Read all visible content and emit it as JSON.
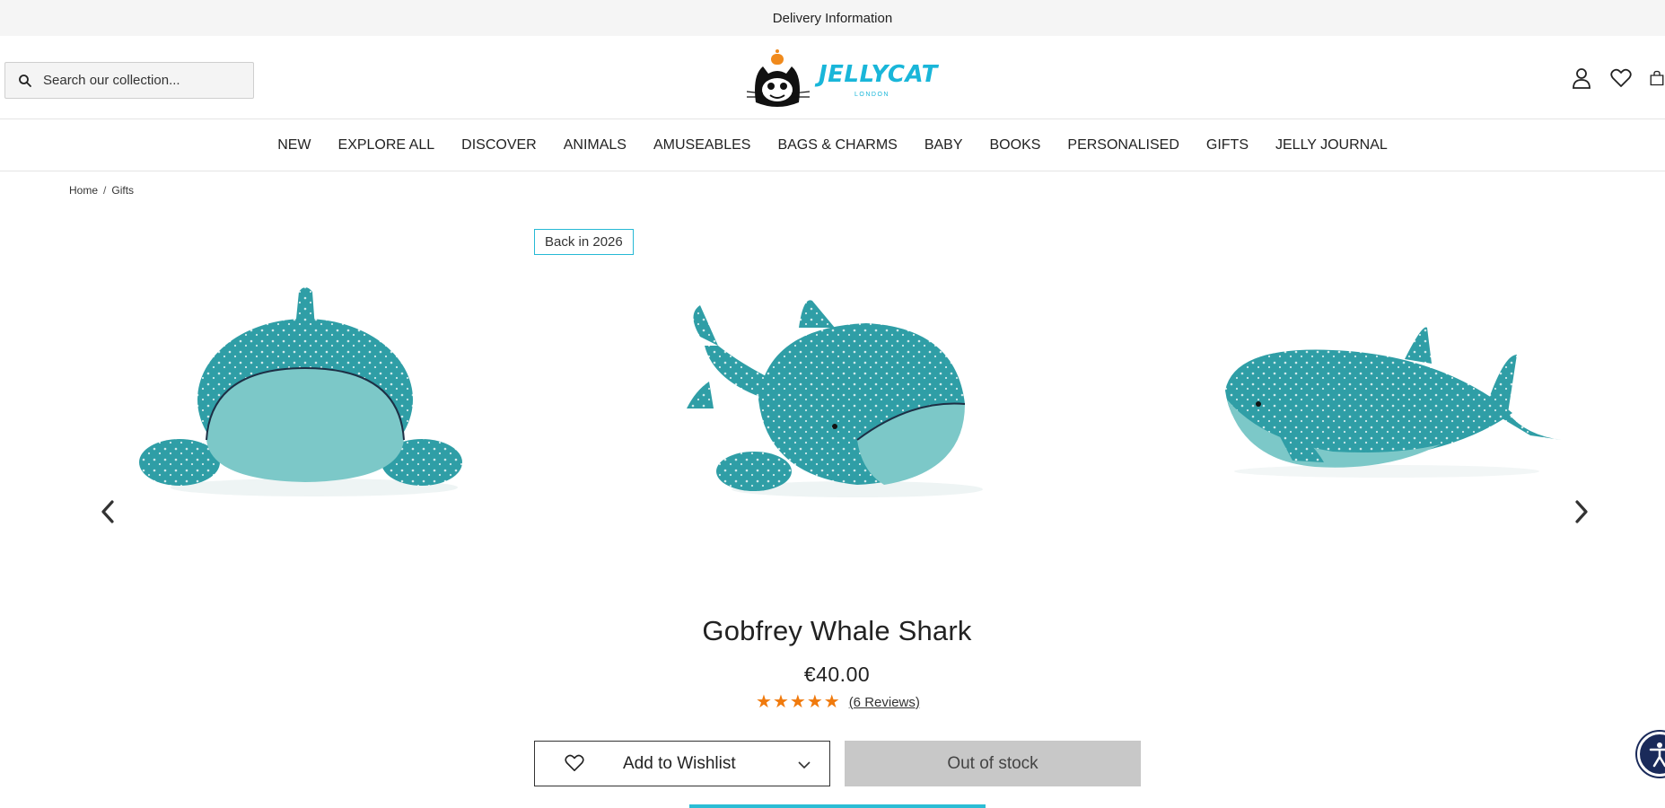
{
  "topbar": {
    "delivery_label": "Delivery Information"
  },
  "header": {
    "search_placeholder": "Search our collection...",
    "logo_text": "JELLYCAT",
    "logo_subtext": "LONDON"
  },
  "nav": {
    "items": [
      {
        "label": "NEW"
      },
      {
        "label": "EXPLORE ALL"
      },
      {
        "label": "DISCOVER"
      },
      {
        "label": "ANIMALS"
      },
      {
        "label": "AMUSEABLES"
      },
      {
        "label": "BAGS & CHARMS"
      },
      {
        "label": "BABY"
      },
      {
        "label": "BOOKS"
      },
      {
        "label": "PERSONALISED"
      },
      {
        "label": "GIFTS"
      },
      {
        "label": "JELLY JOURNAL"
      }
    ]
  },
  "breadcrumb": {
    "home": "Home",
    "separator": "/",
    "current": "Gifts"
  },
  "gallery": {
    "badge": "Back in 2026",
    "images": [
      {
        "alt": "whale-shark-front-view"
      },
      {
        "alt": "whale-shark-angled-view"
      },
      {
        "alt": "whale-shark-side-view"
      }
    ]
  },
  "product": {
    "title": "Gobfrey Whale Shark",
    "price": "€40.00",
    "rating": 5,
    "reviews_label": "(6 Reviews)"
  },
  "actions": {
    "wishlist_label": "Add to Wishlist",
    "stock_label": "Out of stock"
  },
  "colors": {
    "accent": "#2bbdd5",
    "star": "#f07a0d",
    "teal_plush": "#2f9ea6",
    "teal_belly": "#7cc8c8"
  }
}
